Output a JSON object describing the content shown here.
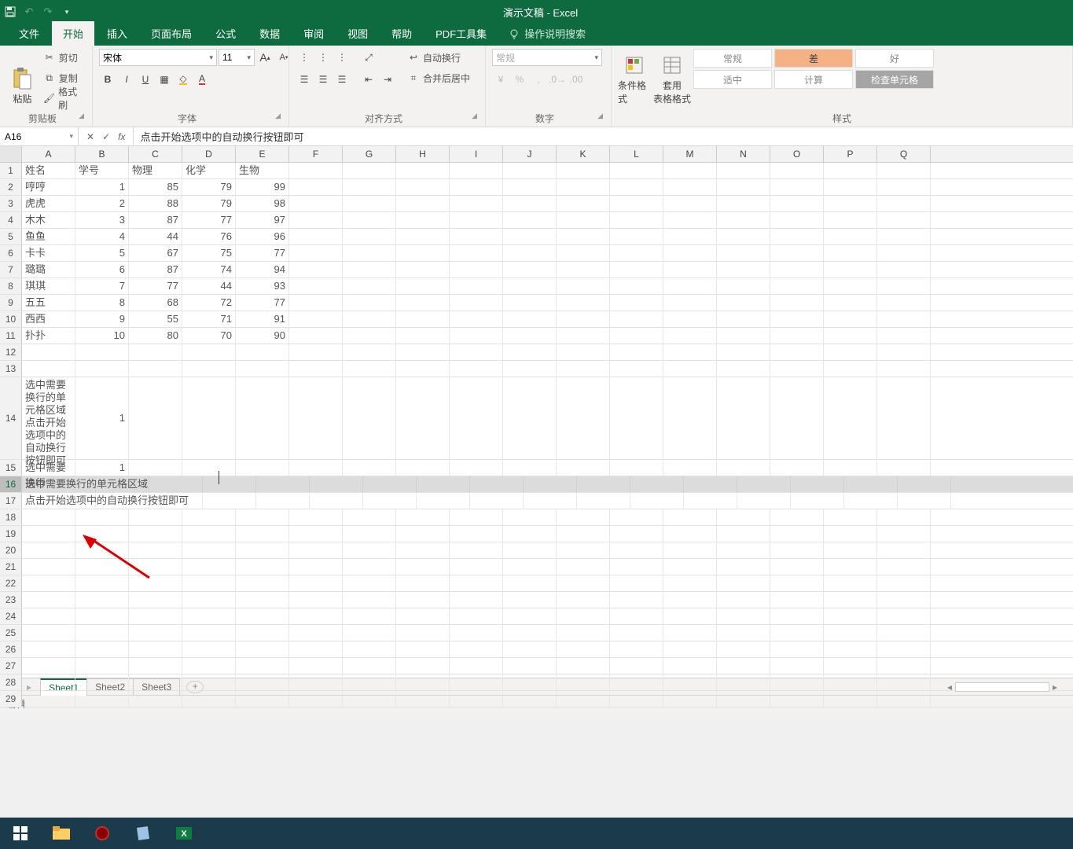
{
  "app": {
    "title": "演示文稿 - Excel"
  },
  "qat": {
    "save": "save",
    "undo": "undo",
    "redo": "redo"
  },
  "tabs": {
    "items": [
      "文件",
      "开始",
      "插入",
      "页面布局",
      "公式",
      "数据",
      "审阅",
      "视图",
      "帮助",
      "PDF工具集"
    ],
    "active": "开始",
    "search_placeholder": "操作说明搜索"
  },
  "ribbon": {
    "clipboard": {
      "label": "剪贴板",
      "paste": "粘贴",
      "cut": "剪切",
      "copy": "复制",
      "painter": "格式刷"
    },
    "font": {
      "label": "字体",
      "name": "宋体",
      "size": "11",
      "grow": "A",
      "shrink": "A",
      "bold": "B",
      "italic": "I",
      "underline": "U"
    },
    "align": {
      "label": "对齐方式",
      "wrap": "自动换行",
      "merge": "合并后居中"
    },
    "number": {
      "label": "数字",
      "format": "常规"
    },
    "styles": {
      "label": "样式",
      "cond": "条件格式",
      "table": "套用\n表格格式",
      "cells": [
        "常规",
        "差",
        "好",
        "适中",
        "计算",
        "检查单元格"
      ]
    }
  },
  "formula": {
    "namebox": "A16",
    "value": "点击开始选项中的自动换行按钮即可"
  },
  "sheet": {
    "cols": [
      "A",
      "B",
      "C",
      "D",
      "E",
      "F",
      "G",
      "H",
      "I",
      "J",
      "K",
      "L",
      "M",
      "N",
      "O",
      "P",
      "Q"
    ],
    "headers": [
      "姓名",
      "学号",
      "物理",
      "化学",
      "生物"
    ],
    "data": [
      [
        "哼哼",
        1,
        85,
        79,
        99
      ],
      [
        "虎虎",
        2,
        88,
        79,
        98
      ],
      [
        "木木",
        3,
        87,
        77,
        97
      ],
      [
        "鱼鱼",
        4,
        44,
        76,
        96
      ],
      [
        "卡卡",
        5,
        67,
        75,
        77
      ],
      [
        "璐璐",
        6,
        87,
        74,
        94
      ],
      [
        "琪琪",
        7,
        77,
        44,
        93
      ],
      [
        "五五",
        8,
        68,
        72,
        77
      ],
      [
        "西西",
        9,
        55,
        71,
        91
      ],
      [
        "扑扑",
        10,
        80,
        70,
        90
      ]
    ],
    "row14_a": "选中需要换行的单元格区域 点击开始选项中的自动换行按钮即可",
    "row14_b": "1",
    "row15_a": "选中需要换行",
    "row15_b": "1",
    "row16": "选中需要换行的单元格区域",
    "row17": "点击开始选项中的自动换行按钮即可"
  },
  "sheet_tabs": {
    "items": [
      "Sheet1",
      "Sheet2",
      "Sheet3"
    ],
    "active": "Sheet1"
  },
  "status": {
    "mode": "编辑"
  }
}
